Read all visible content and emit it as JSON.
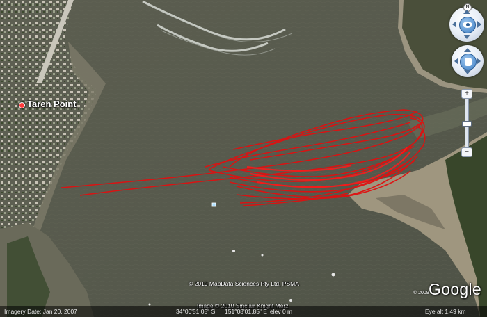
{
  "place": {
    "name": "Taren Point"
  },
  "credits": {
    "line1": "© 2010 MapData Sciences Pty Ltd, PSMA",
    "line2": "Image © 2010 Sinclair Knight Merz",
    "logo": "Google",
    "logo_year": "© 2009"
  },
  "status": {
    "imagery_date": "Imagery Date: Jan 20, 2007",
    "lat": "34°00'51.05\" S",
    "lon": "151°08'01.85\" E",
    "elev": "elev   0 m",
    "eye_alt": "Eye alt    1.49 km"
  },
  "controls": {
    "compass_letter": "N",
    "zoom_in": "+",
    "zoom_out": "−",
    "zoom_level": 0.5
  },
  "colors": {
    "water": "#5a5d4f",
    "track": "#e01010",
    "sand": "#a89f8b",
    "vegetation": "#3e4a30"
  }
}
